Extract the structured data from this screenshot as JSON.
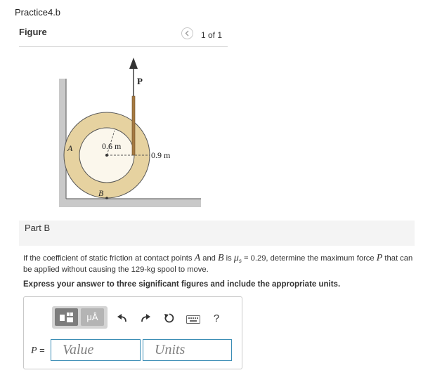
{
  "header": {
    "breadcrumb": "Practice4.b"
  },
  "figure": {
    "title": "Figure",
    "pager": "1 of 1",
    "labels": {
      "force": "P",
      "inner_radius": "0.6 m",
      "outer_radius": "0.9 m",
      "point_a": "A",
      "point_b": "B"
    },
    "colors": {
      "spool": "#e6d2a0",
      "rope": "#a67a43",
      "wall": "#c8c8c8"
    }
  },
  "part": {
    "label": "Part B",
    "problem_pre": "If the coefficient of static friction at contact points ",
    "var_a": "A",
    "and_text": " and ",
    "var_b": "B",
    "is_text": " is ",
    "mu_symbol": "μ",
    "mu_sub": "s",
    "problem_mid": " = 0.29, determine the maximum force ",
    "var_p": "P",
    "problem_post": " that can be applied without causing the 129-kg spool to move.",
    "instruction": "Express your answer to three significant figures and include the appropriate units."
  },
  "answer": {
    "toolbar": {
      "units_glyph": "μÅ",
      "help": "?"
    },
    "var_label": "P",
    "equals": " =",
    "value_placeholder": "Value",
    "units_placeholder": "Units"
  },
  "colors": {
    "accent": "#3b8db5"
  }
}
